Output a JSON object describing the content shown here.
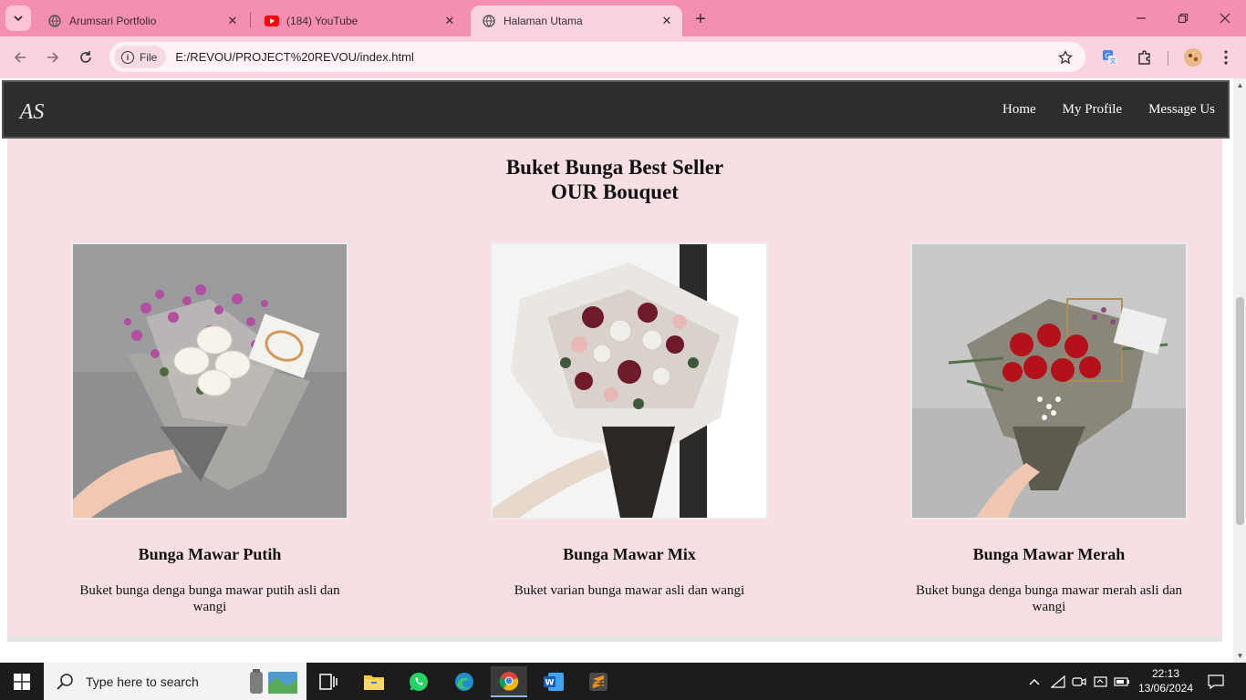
{
  "browser": {
    "tabs": [
      {
        "title": "Arumsari Portfolio",
        "favicon": "globe-icon"
      },
      {
        "title": "(184) YouTube",
        "favicon": "youtube-icon"
      },
      {
        "title": "Halaman Utama",
        "favicon": "globe-icon",
        "active": true
      }
    ],
    "address": {
      "scheme_chip": "File",
      "url": "E:/REVOU/PROJECT%20REVOU/index.html"
    },
    "colors": {
      "tabstrip": "#f48fb1",
      "toolbar": "#fbd3e0"
    }
  },
  "site": {
    "nav": {
      "logo_text": "AS",
      "links": [
        "Home",
        "My Profile",
        "Message Us"
      ]
    },
    "section": {
      "title_line1": "Buket Bunga Best Seller",
      "title_line2": "OUR Bouquet"
    },
    "products": [
      {
        "name": "Bunga Mawar Putih",
        "description": "Buket bunga denga bunga mawar putih asli dan wangi",
        "image": "white-rose-bouquet"
      },
      {
        "name": "Bunga Mawar Mix",
        "description": "Buket varian bunga mawar asli dan wangi",
        "image": "mixed-rose-bouquet"
      },
      {
        "name": "Bunga Mawar Merah",
        "description": "Buket bunga denga bunga mawar merah asli dan wangi",
        "image": "red-rose-bouquet"
      }
    ],
    "colors": {
      "nav_bg": "#2d2d2d",
      "content_bg": "#f7dfe4"
    }
  },
  "taskbar": {
    "search_placeholder": "Type here to search",
    "time": "22:13",
    "date": "13/06/2024"
  }
}
